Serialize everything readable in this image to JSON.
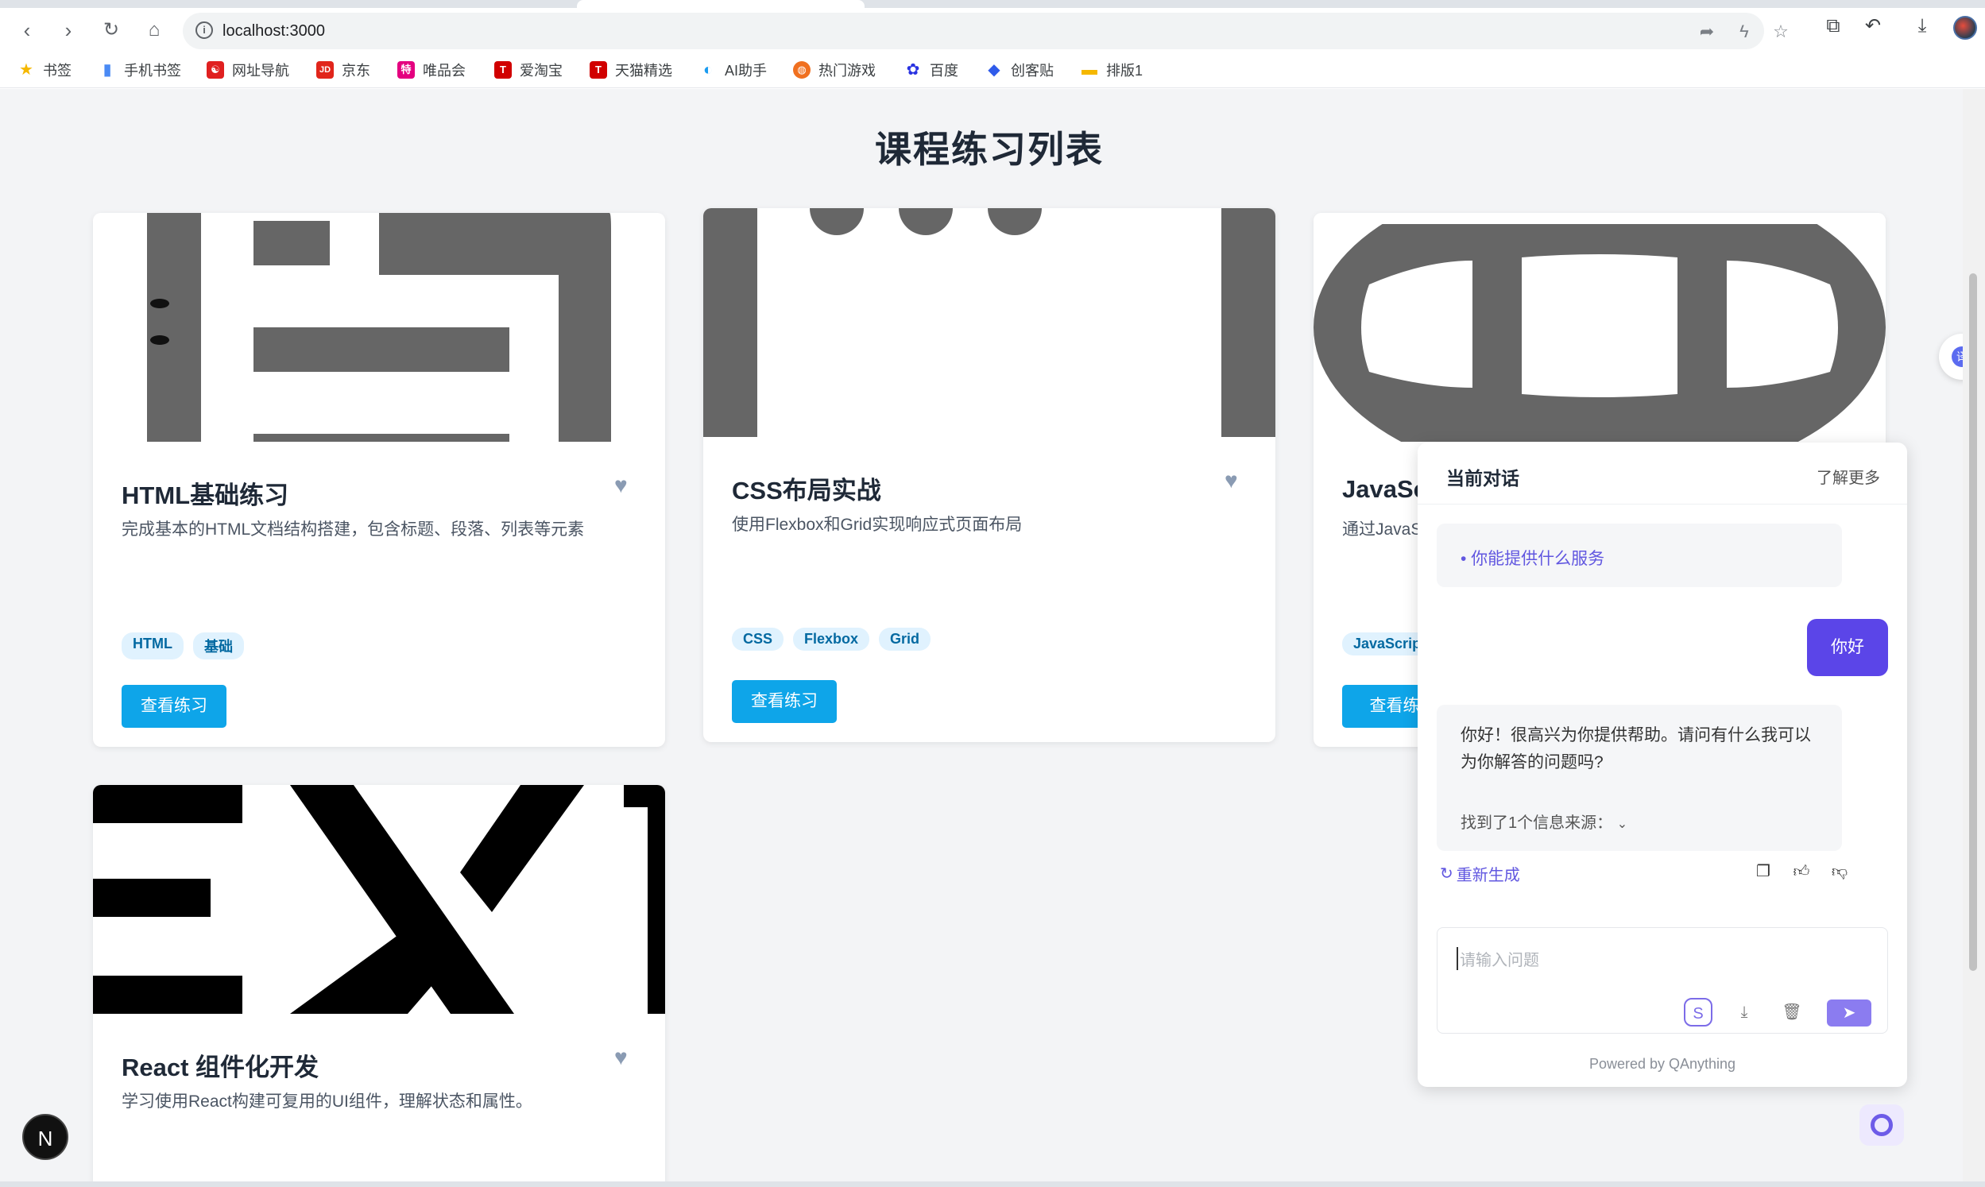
{
  "browser": {
    "url": "localhost:3000",
    "bookmarks": [
      {
        "label": "书签",
        "color": "#f5b800",
        "glyph": "★"
      },
      {
        "label": "手机书签",
        "color": "#4a8af4",
        "glyph": "▮"
      },
      {
        "label": "网址导航",
        "color": "#e02020",
        "glyph": "☯"
      },
      {
        "label": "京东",
        "color": "#e1251b",
        "glyph": "JD"
      },
      {
        "label": "唯品会",
        "color": "#e4007f",
        "glyph": "特"
      },
      {
        "label": "爱淘宝",
        "color": "#d10000",
        "glyph": "T"
      },
      {
        "label": "天猫精选",
        "color": "#d10000",
        "glyph": "T"
      },
      {
        "label": "AI助手",
        "color": "#1a9bf0",
        "glyph": "◐"
      },
      {
        "label": "热门游戏",
        "color": "#f07020",
        "glyph": "◍"
      },
      {
        "label": "百度",
        "color": "#2932e1",
        "glyph": "✿"
      },
      {
        "label": "创客贴",
        "color": "#2f5bea",
        "glyph": "◆"
      },
      {
        "label": "排版1",
        "color": "#f5b800",
        "glyph": "▬"
      }
    ]
  },
  "page": {
    "title": "课程练习列表",
    "cards": [
      {
        "title": "HTML基础练习",
        "desc": "完成基本的HTML文档结构搭建，包含标题、段落、列表等元素",
        "tags": [
          "HTML",
          "基础"
        ],
        "button": "查看练习"
      },
      {
        "title": "CSS布局实战",
        "desc": "使用Flexbox和Grid实现响应式页面布局",
        "tags": [
          "CSS",
          "Flexbox",
          "Grid"
        ],
        "button": "查看练习"
      },
      {
        "title": "JavaSc",
        "desc": "通过JavaS",
        "tags": [
          "JavaScrip"
        ],
        "button": "查看练"
      },
      {
        "title": "React 组件化开发",
        "desc": "学习使用React构建可复用的UI组件，理解状态和属性。"
      }
    ]
  },
  "chat": {
    "title": "当前对话",
    "learn_more": "了解更多",
    "suggestion": "• 你能提供什么服务",
    "user_message": "你好",
    "bot_message": "你好！很高兴为你提供帮助。请问有什么我可以为你解答的问题吗?",
    "sources": "找到了1个信息来源：",
    "regenerate": "重新生成",
    "input_placeholder": "请输入问题",
    "powered_by": "Powered by QAnything"
  },
  "misc": {
    "next_badge": "N",
    "translate": "译"
  }
}
